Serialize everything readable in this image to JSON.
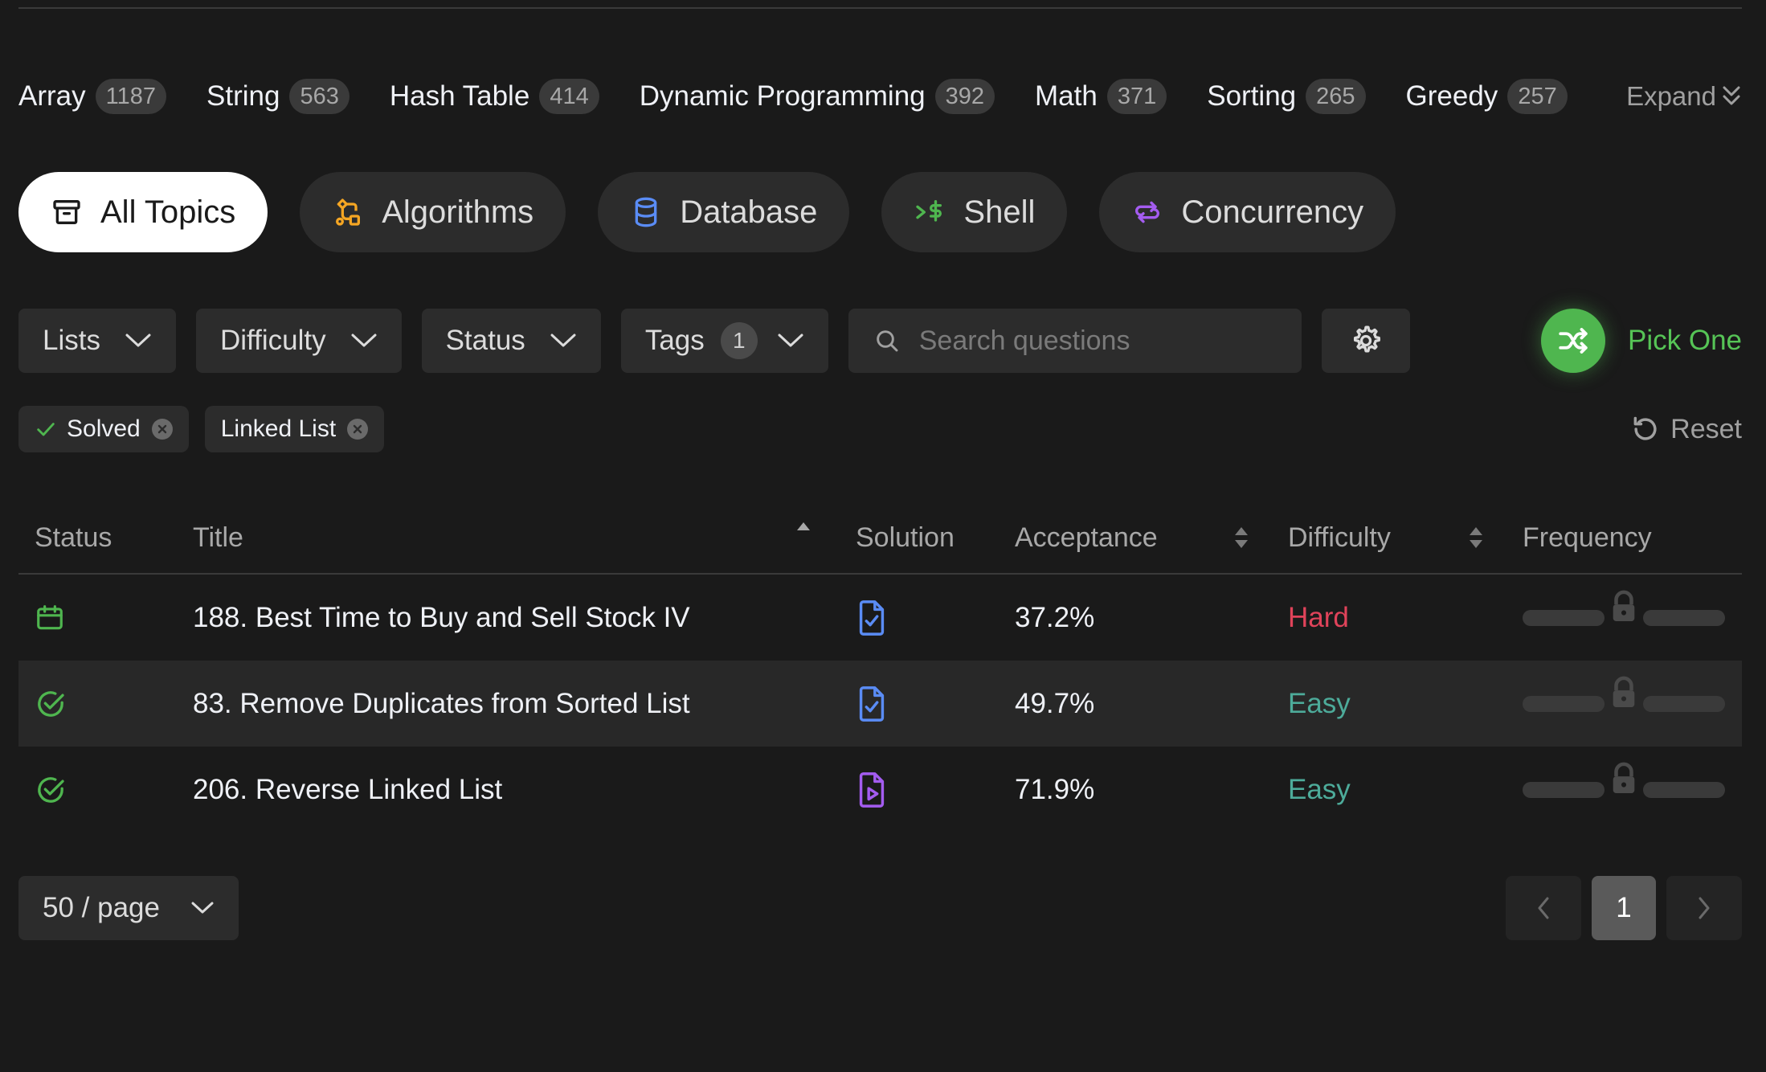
{
  "tags": [
    {
      "name": "Array",
      "count": "1187"
    },
    {
      "name": "String",
      "count": "563"
    },
    {
      "name": "Hash Table",
      "count": "414"
    },
    {
      "name": "Dynamic Programming",
      "count": "392"
    },
    {
      "name": "Math",
      "count": "371"
    },
    {
      "name": "Sorting",
      "count": "265"
    },
    {
      "name": "Greedy",
      "count": "257"
    }
  ],
  "expand_label": "Expand",
  "categories": [
    {
      "label": "All Topics",
      "icon": "archive-icon",
      "color": "#1a1a1a"
    },
    {
      "label": "Algorithms",
      "icon": "algorithm-icon",
      "color": "#f5a623"
    },
    {
      "label": "Database",
      "icon": "database-icon",
      "color": "#5a8cf5"
    },
    {
      "label": "Shell",
      "icon": "terminal-dollar-icon",
      "color": "#4fb64f"
    },
    {
      "label": "Concurrency",
      "icon": "arrows-swap-icon",
      "color": "#a45cf0"
    }
  ],
  "filters": {
    "lists": "Lists",
    "difficulty": "Difficulty",
    "status": "Status",
    "tags": "Tags",
    "tags_count": "1",
    "search_placeholder": "Search questions",
    "pick_one": "Pick One"
  },
  "chips": {
    "solved": "Solved",
    "linked_list": "Linked List",
    "reset": "Reset"
  },
  "table": {
    "headers": {
      "status": "Status",
      "title": "Title",
      "solution": "Solution",
      "acceptance": "Acceptance",
      "difficulty": "Difficulty",
      "frequency": "Frequency"
    },
    "rows": [
      {
        "status_icon": "calendar-icon",
        "title": "188. Best Time to Buy and Sell Stock IV",
        "solution_icon": "doc-check-icon",
        "acceptance": "37.2%",
        "difficulty": "Hard"
      },
      {
        "status_icon": "check-circle-icon",
        "title": "83. Remove Duplicates from Sorted List",
        "solution_icon": "doc-check-icon",
        "acceptance": "49.7%",
        "difficulty": "Easy"
      },
      {
        "status_icon": "check-circle-icon",
        "title": "206. Reverse Linked List",
        "solution_icon": "doc-video-icon",
        "acceptance": "71.9%",
        "difficulty": "Easy"
      }
    ]
  },
  "pagination": {
    "per_page": "50 / page",
    "current": "1"
  },
  "colors": {
    "background": "#1a1a1a",
    "accent_green": "#4fb64f",
    "hard": "#e0435a",
    "easy": "#4dab9a"
  }
}
